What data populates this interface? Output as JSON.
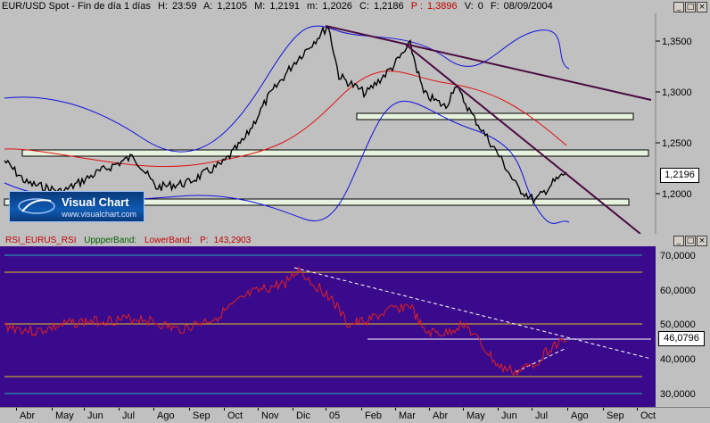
{
  "header": {
    "symbol": "EUR/USD Spot - Fin de día 1 días",
    "h_label": "H:",
    "h_value": "23:59",
    "a_label": "A:",
    "a_value": "1,2105",
    "m_label": "M:",
    "m_value": "1,2191",
    "m2_label": "m:",
    "m2_value": "1,2026",
    "c_label": "C:",
    "c_value": "1,2186",
    "p_label": "P :",
    "p_value": "1,3896",
    "v_label": "V:",
    "v_value": "0",
    "f_label": "F:",
    "f_value": "08/09/2004"
  },
  "price_panel": {
    "y_ticks": [
      "1,3500",
      "1,3000",
      "1,2500",
      "1,2196",
      "1,2000"
    ],
    "current_price": "1,2196"
  },
  "logo": {
    "name": "Visual Chart",
    "url": "www.visualchart.com"
  },
  "rsi_panel": {
    "title": "RSI_EURUS_RSI",
    "upper_label": "UppperBand:",
    "lower_label": "LowerBand:",
    "p_label": "P:",
    "p_value": "143,2903",
    "y_ticks": [
      "70,0000",
      "60,0000",
      "50,0000",
      "40,0000",
      "30,0000"
    ],
    "current_value": "46,0796"
  },
  "x_axis": [
    "Abr",
    "May",
    "Jun",
    "Jul",
    "Ago",
    "Sep",
    "Oct",
    "Nov",
    "Dic",
    "05",
    "Feb",
    "Mar",
    "Abr",
    "May",
    "Jun",
    "Jul",
    "Ago",
    "Sep",
    "Oct"
  ],
  "window_buttons": [
    "_",
    "□",
    "×"
  ],
  "colors": {
    "price_bg": "#c0c0c0",
    "rsi_bg": "#3a0a8c",
    "price_line": "#000000",
    "ma_line": "#e01010",
    "band_line": "#1010e0",
    "trend_line": "#4a0a40",
    "rsi_line": "#e02020"
  }
}
